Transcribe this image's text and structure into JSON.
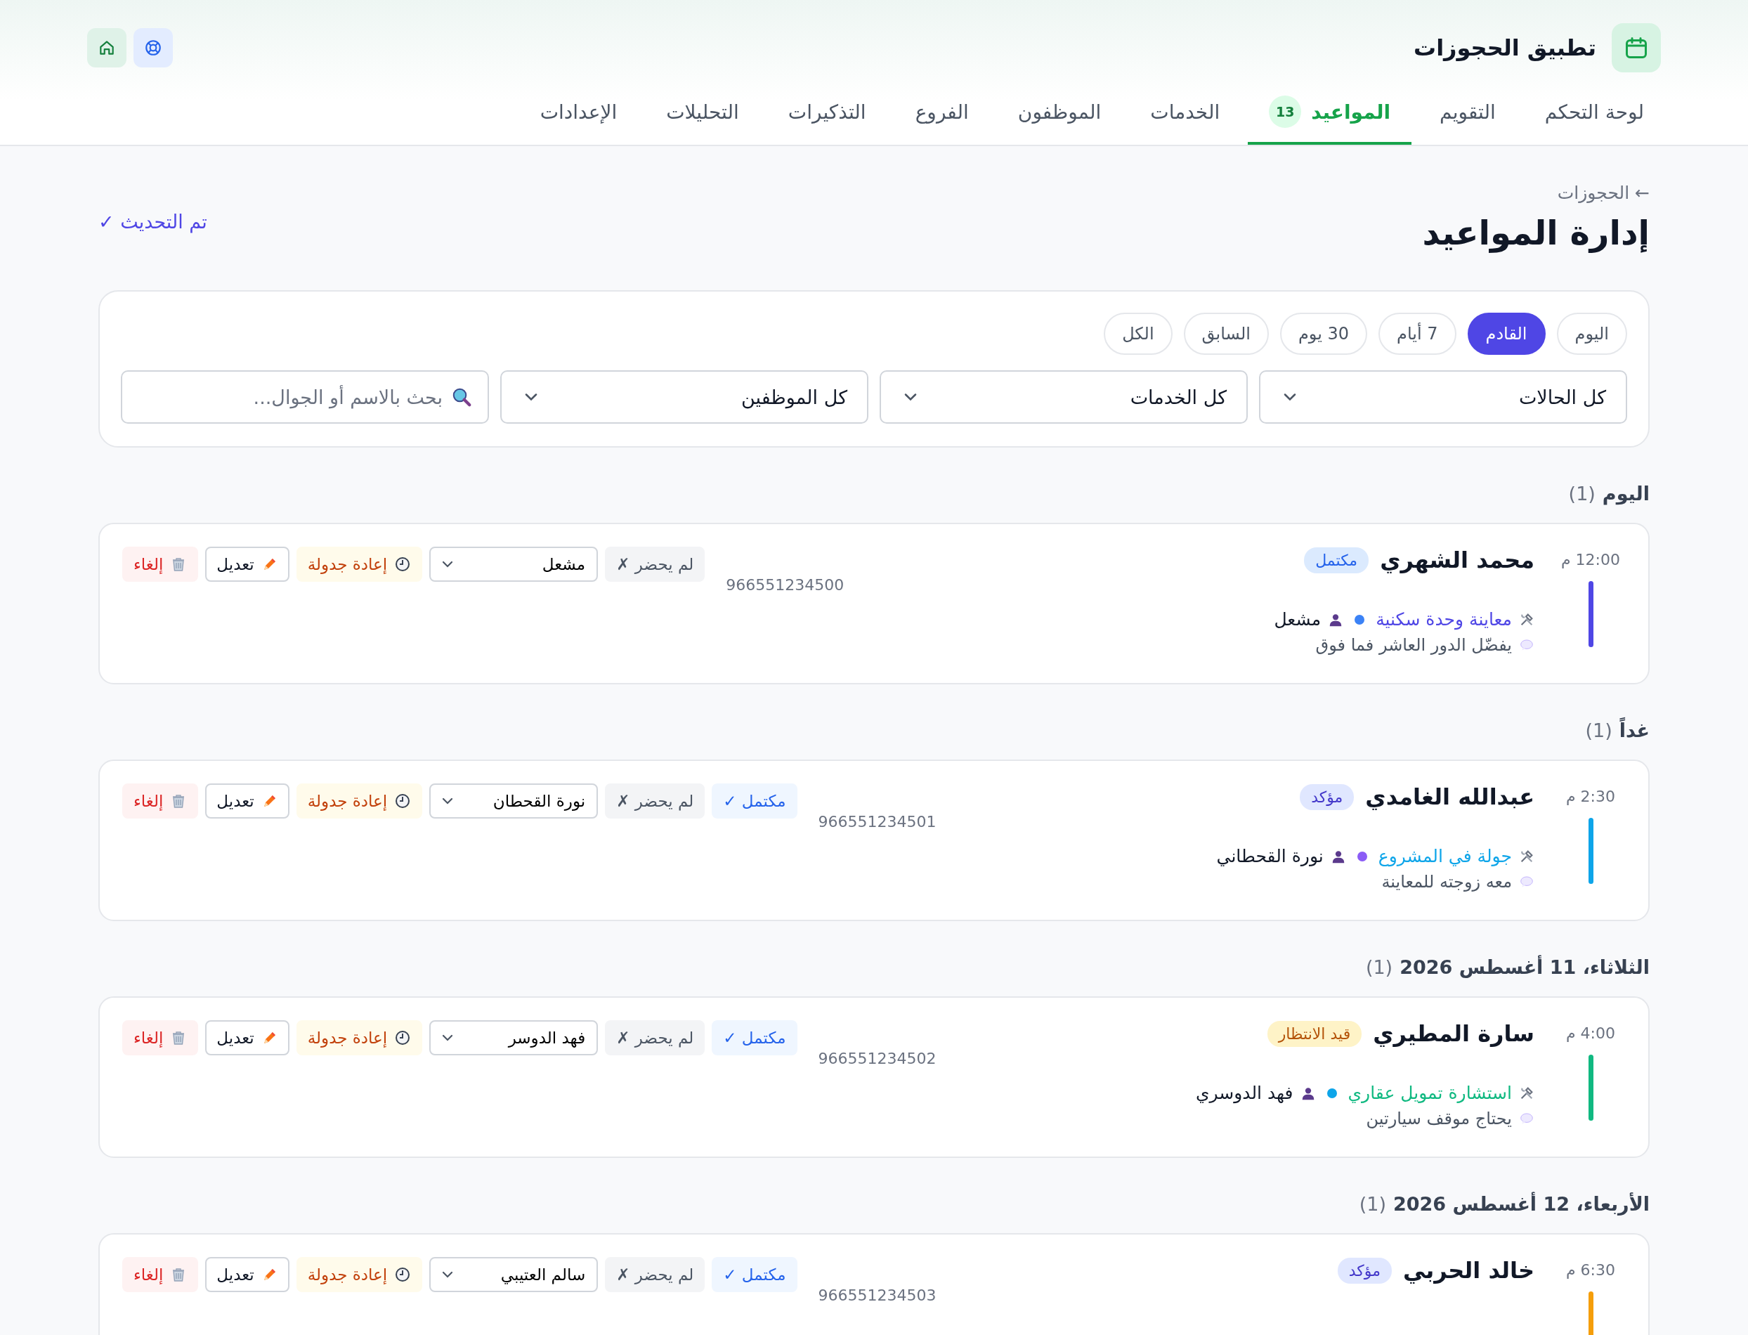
{
  "app": {
    "title": "تطبيق الحجوزات"
  },
  "tabs": [
    {
      "label": "لوحة التحكم",
      "selected": false
    },
    {
      "label": "التقويم",
      "selected": false
    },
    {
      "label": "المواعيد",
      "selected": true,
      "badge": "13"
    },
    {
      "label": "الخدمات",
      "selected": false
    },
    {
      "label": "الموظفون",
      "selected": false
    },
    {
      "label": "الفروع",
      "selected": false
    },
    {
      "label": "التذكيرات",
      "selected": false
    },
    {
      "label": "التحليلات",
      "selected": false
    },
    {
      "label": "الإعدادات",
      "selected": false
    }
  ],
  "breadcrumb": "← الحجوزات",
  "page_title": "إدارة المواعيد",
  "refresh_status": "تم التحديث ✓",
  "filters": {
    "ranges": [
      {
        "label": "اليوم",
        "selected": false
      },
      {
        "label": "القادم",
        "selected": true
      },
      {
        "label": "7 أيام",
        "selected": false
      },
      {
        "label": "30 يوم",
        "selected": false
      },
      {
        "label": "السابق",
        "selected": false
      },
      {
        "label": "الكل",
        "selected": false
      }
    ],
    "selects": [
      "كل الحالات",
      "كل الخدمات",
      "كل الموظفين"
    ],
    "search": {
      "placeholder": "بحث بالاسم أو الجوال..."
    }
  },
  "groups": [
    {
      "title": "اليوم",
      "count": "(1)",
      "appointments": [
        {
          "time": "12:00 م",
          "color": "#4f46e5",
          "name": "محمد الشهري",
          "status": {
            "label": "مكتمل",
            "kind": "completed"
          },
          "phone": "966551234500",
          "service": "معاينة وحدة سكنية",
          "staff": {
            "name": "مشعل",
            "color": "#3b82f6"
          },
          "note": "يفضّل الدور العاشر فما فوق",
          "actions": [
            {
              "kind": "no_show",
              "label": "لم يحضر ✗"
            },
            {
              "kind": "staff_select",
              "label": "مشعل"
            },
            {
              "kind": "reschedule",
              "label": "إعادة جدولة"
            },
            {
              "kind": "edit",
              "label": "تعديل"
            },
            {
              "kind": "cancel",
              "label": "إلغاء"
            }
          ]
        }
      ]
    },
    {
      "title": "غداً",
      "count": "(1)",
      "appointments": [
        {
          "time": "2:30 م",
          "color": "#0ea5e9",
          "name": "عبدالله الغامدي",
          "status": {
            "label": "مؤكد",
            "kind": "confirmed"
          },
          "phone": "966551234501",
          "service": "جولة في المشروع",
          "staff": {
            "name": "نورة القحطاني",
            "color": "#8b5cf6"
          },
          "note": "معه زوجته للمعاينة",
          "actions": [
            {
              "kind": "complete",
              "label": "مكتمل ✓"
            },
            {
              "kind": "no_show",
              "label": "لم يحضر ✗"
            },
            {
              "kind": "staff_select",
              "label": "نورة القحطان"
            },
            {
              "kind": "reschedule",
              "label": "إعادة جدولة"
            },
            {
              "kind": "edit",
              "label": "تعديل"
            },
            {
              "kind": "cancel",
              "label": "إلغاء"
            }
          ]
        }
      ]
    },
    {
      "title": "الثلاثاء، 11 أغسطس 2026",
      "count": "(1)",
      "appointments": [
        {
          "time": "4:00 م",
          "color": "#10b981",
          "name": "سارة المطيري",
          "status": {
            "label": "قيد الانتظار",
            "kind": "pending"
          },
          "phone": "966551234502",
          "service": "استشارة تمويل عقاري",
          "staff": {
            "name": "فهد الدوسري",
            "color": "#0ea5e9"
          },
          "note": "يحتاج موقف سيارتين",
          "actions": [
            {
              "kind": "complete",
              "label": "مكتمل ✓"
            },
            {
              "kind": "no_show",
              "label": "لم يحضر ✗"
            },
            {
              "kind": "staff_select",
              "label": "فهد الدوسر"
            },
            {
              "kind": "reschedule",
              "label": "إعادة جدولة"
            },
            {
              "kind": "edit",
              "label": "تعديل"
            },
            {
              "kind": "cancel",
              "label": "إلغاء"
            }
          ]
        }
      ]
    },
    {
      "title": "الأربعاء، 12 أغسطس 2026",
      "count": "(1)",
      "appointments": [
        {
          "time": "6:30 م",
          "color": "#f59e0b",
          "name": "خالد الحربي",
          "status": {
            "label": "مؤكد",
            "kind": "confirmed"
          },
          "phone": "966551234503",
          "actions": [
            {
              "kind": "complete",
              "label": "مكتمل ✓"
            },
            {
              "kind": "no_show",
              "label": "لم يحضر ✗"
            },
            {
              "kind": "staff_select",
              "label": "سالم العتيبي"
            },
            {
              "kind": "reschedule",
              "label": "إعادة جدولة"
            },
            {
              "kind": "edit",
              "label": "تعديل"
            },
            {
              "kind": "cancel",
              "label": "إلغاء"
            }
          ]
        }
      ]
    }
  ]
}
